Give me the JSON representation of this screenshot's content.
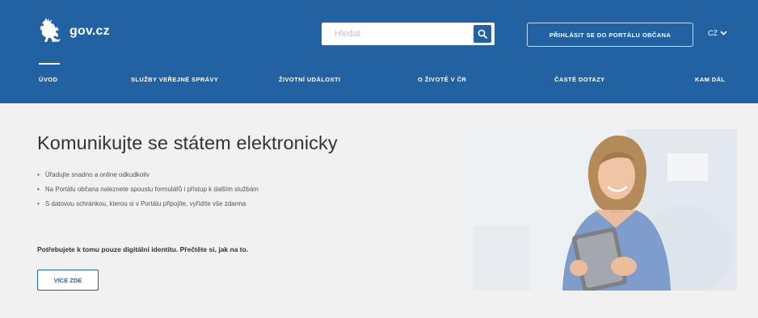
{
  "header": {
    "logo_text": "gov.cz",
    "search_placeholder": "Hledat",
    "login_label": "PŘIHLÁSIT SE DO PORTÁLU OBČANA",
    "language": "CZ"
  },
  "nav": {
    "items": [
      {
        "label": "ÚVOD",
        "active": true
      },
      {
        "label": "SLUŽBY VEŘEJNÉ SPRÁVY",
        "active": false
      },
      {
        "label": "ŽIVOTNÍ UDÁLOSTI",
        "active": false
      },
      {
        "label": "O ŽIVOTĚ V ČR",
        "active": false
      },
      {
        "label": "ČASTÉ DOTAZY",
        "active": false
      },
      {
        "label": "KAM DÁL",
        "active": false
      }
    ]
  },
  "hero": {
    "title": "Komunikujte se státem elektronicky",
    "bullets": [
      "Úřadujte snadno a online odkudkoliv",
      "Na Portálu občana naleznete spoustu formulářů i přístup k dalším službám",
      "S datovou schránkou, kterou si v Portálu připojíte, vyřídíte vše zdarma"
    ],
    "digital_identity_text": "Potřebujete k tomu pouze digitální identitu. Přečtěte si, jak na to.",
    "more_button": "VÍCE ZDE"
  },
  "colors": {
    "brand_blue": "#2362a2",
    "background": "#f1f1f1",
    "white": "#ffffff"
  },
  "icons": {
    "logo": "czech-lion-icon",
    "search": "search-icon",
    "language_dropdown": "chevron-down-icon"
  }
}
